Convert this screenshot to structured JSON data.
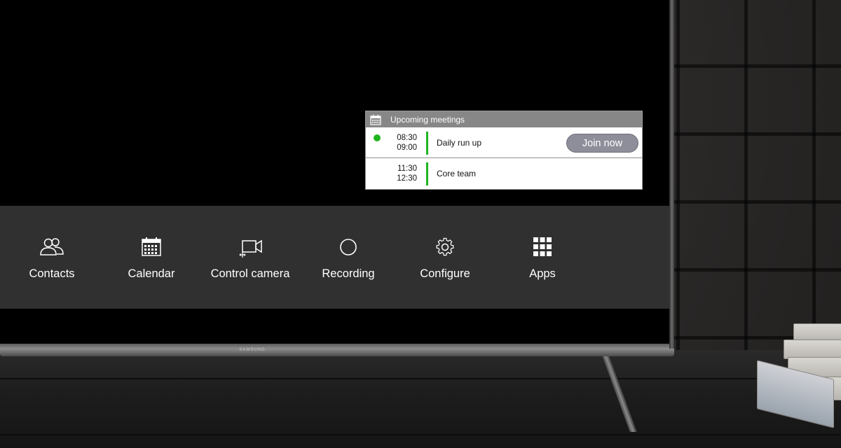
{
  "tv": {
    "brand": "SAMSUNG"
  },
  "meetings": {
    "title": "Upcoming meetings",
    "items": [
      {
        "start": "08:30",
        "end": "09:00",
        "name": "Daily run up",
        "live": true,
        "action": "Join now"
      },
      {
        "start": "11:30",
        "end": "12:30",
        "name": "Core team",
        "live": false
      }
    ]
  },
  "toolbar": {
    "items": [
      {
        "label": "Contacts",
        "icon": "contacts-icon"
      },
      {
        "label": "Calendar",
        "icon": "calendar-icon"
      },
      {
        "label": "Control camera",
        "icon": "camera-icon"
      },
      {
        "label": "Recording",
        "icon": "record-icon"
      },
      {
        "label": "Configure",
        "icon": "gear-icon"
      },
      {
        "label": "Apps",
        "icon": "apps-grid-icon"
      }
    ]
  },
  "colors": {
    "live_green": "#1eb51e",
    "toolbar_bg": "#303030",
    "header_gray": "#878787",
    "join_button": "#8e8e9a"
  }
}
